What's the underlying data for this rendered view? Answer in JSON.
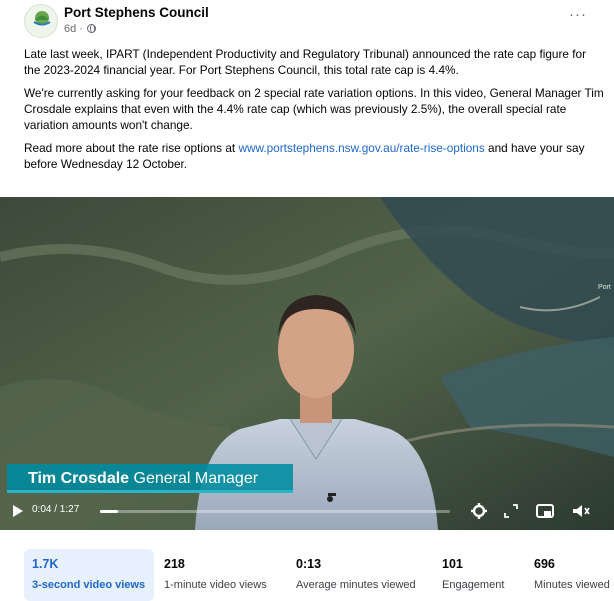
{
  "post": {
    "page_name": "Port Stephens Council",
    "meta": "6d ·",
    "avatar_label": "PORT STEPHENS",
    "more_label": "···",
    "paragraph1": "Late last week, IPART (Independent Productivity and Regulatory Tribunal) announced the rate cap figure for the 2023-2024 financial year. For Port Stephens Council, this total rate cap is 4.4%.",
    "paragraph2": "We're currently asking for your feedback on 2 special rate variation options. In this video, General Manager Tim Crosdale explains that even with the 4.4% rate cap (which was previously 2.5%), the overall special rate variation amounts won't change.",
    "paragraph3_before": "Read more about the rate rise options at ",
    "paragraph3_link": "www.portstephens.nsw.gov.au/rate-rise-options",
    "paragraph3_after": " and have your say before Wednesday 12 October."
  },
  "video": {
    "caption_name": "Tim Crosdale",
    "caption_role": " General Manager",
    "map_label": "Port",
    "time": "0:04 / 1:27",
    "progress": 0.05
  },
  "stats": [
    {
      "value": "1.7K",
      "label": "3-second video views",
      "active": true
    },
    {
      "value": "218",
      "label": "1-minute video views",
      "active": false
    },
    {
      "value": "0:13",
      "label": "Average minutes viewed",
      "active": false
    },
    {
      "value": "101",
      "label": "Engagement",
      "active": false
    },
    {
      "value": "696",
      "label": "Minutes viewed",
      "active": false
    }
  ],
  "colors": {
    "accent": "#1f67c9",
    "caption_bg": "#008ca0",
    "active_stat_bg": "#e7f0fd"
  }
}
